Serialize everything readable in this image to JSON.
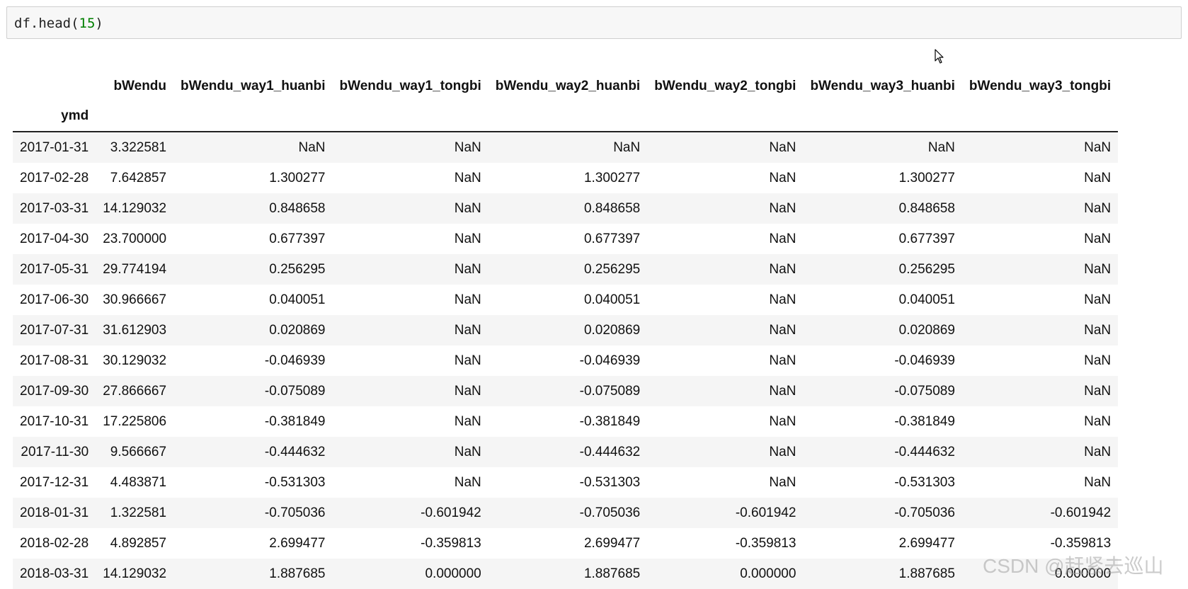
{
  "code_cell": {
    "prefix": "df.head(",
    "arg": "15",
    "suffix": ")"
  },
  "dataframe": {
    "index_name": "ymd",
    "columns": [
      "bWendu",
      "bWendu_way1_huanbi",
      "bWendu_way1_tongbi",
      "bWendu_way2_huanbi",
      "bWendu_way2_tongbi",
      "bWendu_way3_huanbi",
      "bWendu_way3_tongbi"
    ],
    "rows": [
      {
        "index": "2017-01-31",
        "values": [
          "3.322581",
          "NaN",
          "NaN",
          "NaN",
          "NaN",
          "NaN",
          "NaN"
        ]
      },
      {
        "index": "2017-02-28",
        "values": [
          "7.642857",
          "1.300277",
          "NaN",
          "1.300277",
          "NaN",
          "1.300277",
          "NaN"
        ]
      },
      {
        "index": "2017-03-31",
        "values": [
          "14.129032",
          "0.848658",
          "NaN",
          "0.848658",
          "NaN",
          "0.848658",
          "NaN"
        ]
      },
      {
        "index": "2017-04-30",
        "values": [
          "23.700000",
          "0.677397",
          "NaN",
          "0.677397",
          "NaN",
          "0.677397",
          "NaN"
        ]
      },
      {
        "index": "2017-05-31",
        "values": [
          "29.774194",
          "0.256295",
          "NaN",
          "0.256295",
          "NaN",
          "0.256295",
          "NaN"
        ]
      },
      {
        "index": "2017-06-30",
        "values": [
          "30.966667",
          "0.040051",
          "NaN",
          "0.040051",
          "NaN",
          "0.040051",
          "NaN"
        ]
      },
      {
        "index": "2017-07-31",
        "values": [
          "31.612903",
          "0.020869",
          "NaN",
          "0.020869",
          "NaN",
          "0.020869",
          "NaN"
        ]
      },
      {
        "index": "2017-08-31",
        "values": [
          "30.129032",
          "-0.046939",
          "NaN",
          "-0.046939",
          "NaN",
          "-0.046939",
          "NaN"
        ]
      },
      {
        "index": "2017-09-30",
        "values": [
          "27.866667",
          "-0.075089",
          "NaN",
          "-0.075089",
          "NaN",
          "-0.075089",
          "NaN"
        ]
      },
      {
        "index": "2017-10-31",
        "values": [
          "17.225806",
          "-0.381849",
          "NaN",
          "-0.381849",
          "NaN",
          "-0.381849",
          "NaN"
        ]
      },
      {
        "index": "2017-11-30",
        "values": [
          "9.566667",
          "-0.444632",
          "NaN",
          "-0.444632",
          "NaN",
          "-0.444632",
          "NaN"
        ]
      },
      {
        "index": "2017-12-31",
        "values": [
          "4.483871",
          "-0.531303",
          "NaN",
          "-0.531303",
          "NaN",
          "-0.531303",
          "NaN"
        ]
      },
      {
        "index": "2018-01-31",
        "values": [
          "1.322581",
          "-0.705036",
          "-0.601942",
          "-0.705036",
          "-0.601942",
          "-0.705036",
          "-0.601942"
        ]
      },
      {
        "index": "2018-02-28",
        "values": [
          "4.892857",
          "2.699477",
          "-0.359813",
          "2.699477",
          "-0.359813",
          "2.699477",
          "-0.359813"
        ]
      },
      {
        "index": "2018-03-31",
        "values": [
          "14.129032",
          "1.887685",
          "0.000000",
          "1.887685",
          "0.000000",
          "1.887685",
          "0.000000"
        ]
      }
    ]
  },
  "watermark": "CSDN @赶紧去巡山",
  "icons": {
    "cursor": "mouse-pointer-icon"
  },
  "colors": {
    "code_number": "#008000",
    "cell_background": "#f7f7f7",
    "row_stripe": "#f5f5f5"
  }
}
